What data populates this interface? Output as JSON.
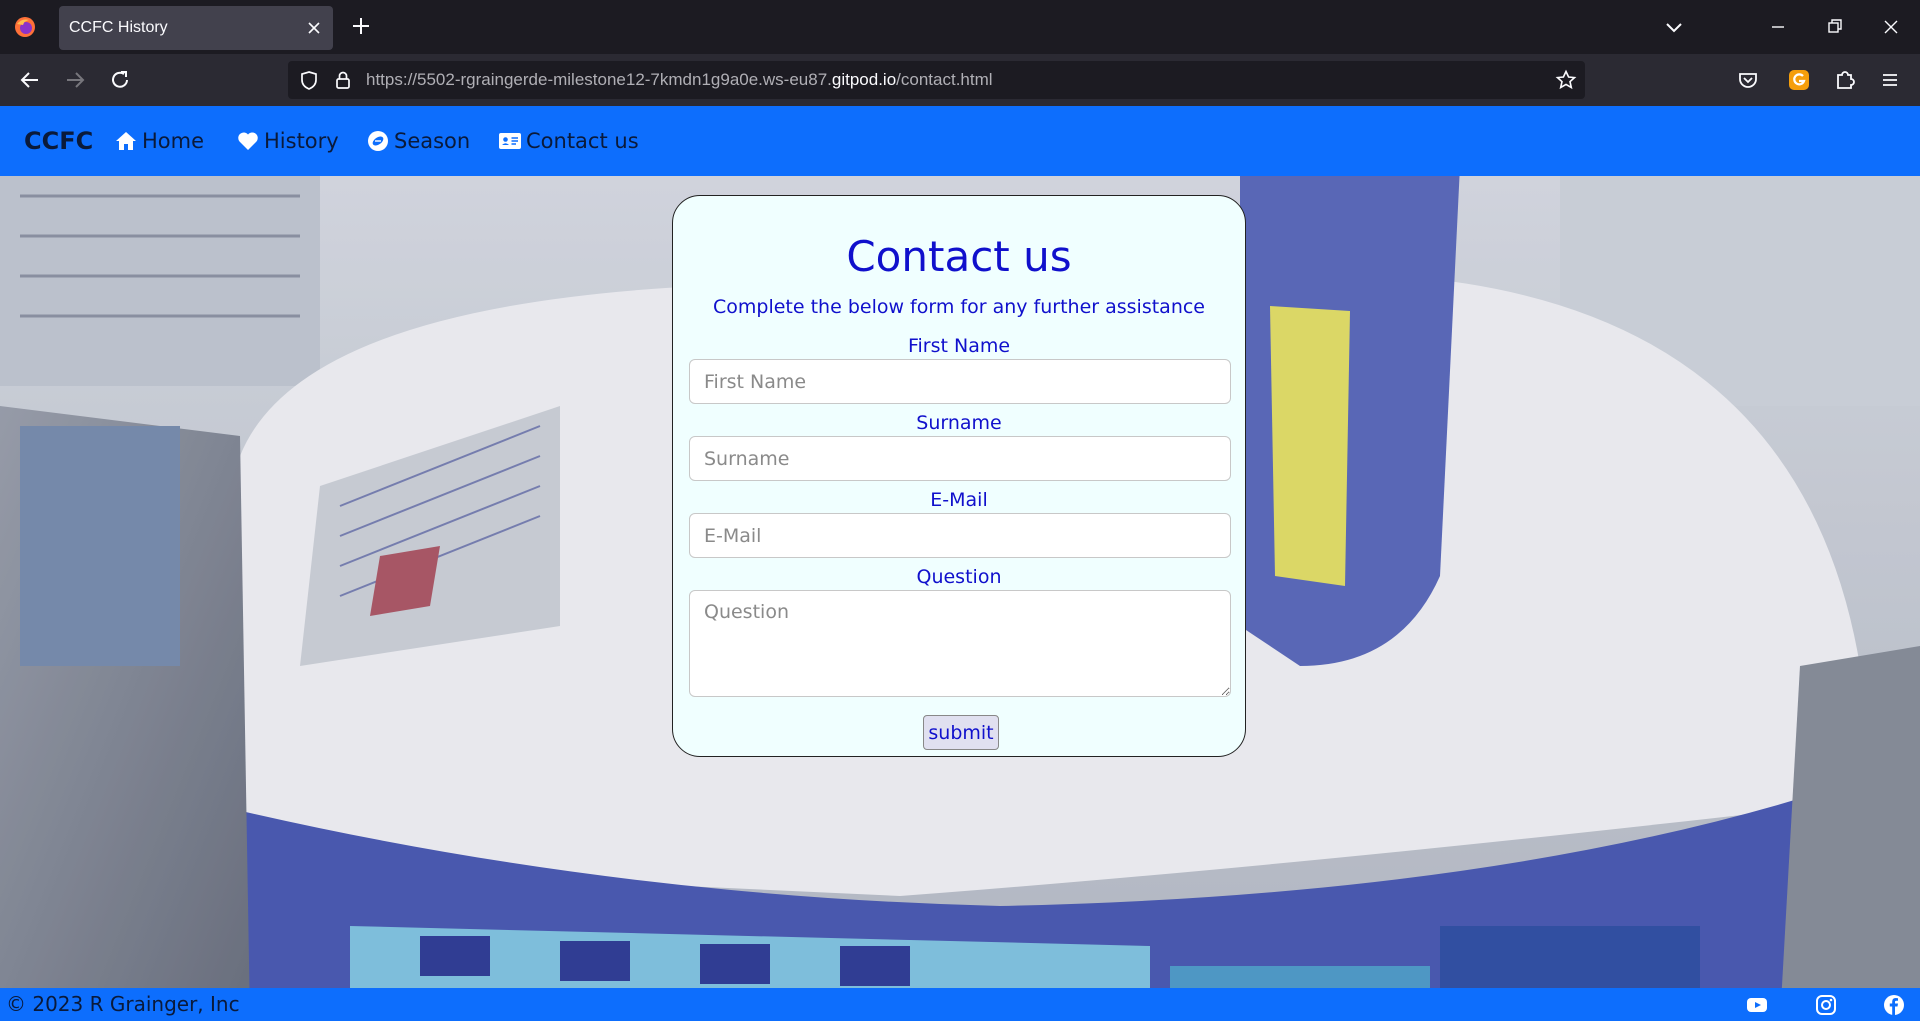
{
  "browser": {
    "tab_title": "CCFC History",
    "url_prefix": "https://5502-rgraingerde-milestone12-7kmdn1g9a0e.ws-eu87.",
    "url_host": "gitpod.io",
    "url_path": "/contact.html"
  },
  "site": {
    "brand": "CCFC",
    "nav": [
      {
        "label": "Home",
        "icon": "home-icon"
      },
      {
        "label": "History",
        "icon": "heart-icon"
      },
      {
        "label": "Season",
        "icon": "football-icon"
      },
      {
        "label": "Contact us",
        "icon": "id-card-icon"
      }
    ]
  },
  "form": {
    "title": "Contact us",
    "subtitle": "Complete the below form for any further assistance",
    "fields": [
      {
        "label": "First Name",
        "placeholder": "First Name"
      },
      {
        "label": "Surname",
        "placeholder": "Surname"
      },
      {
        "label": "E-Mail",
        "placeholder": "E-Mail"
      },
      {
        "label": "Question",
        "placeholder": "Question"
      }
    ],
    "submit_label": "submit"
  },
  "footer": {
    "copyright": "© 2023 R Grainger, Inc",
    "social": [
      "youtube-icon",
      "instagram-icon",
      "facebook-icon"
    ]
  },
  "colors": {
    "nav_blue": "#0d6efd",
    "card_bg": "#f0ffff",
    "form_text": "#1010cc"
  }
}
